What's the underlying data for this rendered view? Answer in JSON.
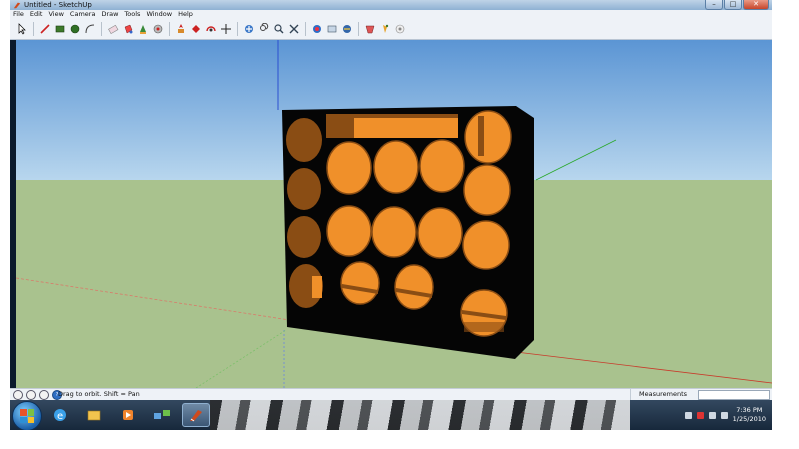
{
  "window": {
    "title": "Untitled - SketchUp",
    "buttons": [
      "–",
      "□",
      "✕"
    ]
  },
  "menu": [
    "File",
    "Edit",
    "View",
    "Camera",
    "Draw",
    "Tools",
    "Window",
    "Help"
  ],
  "toolbar": {
    "tools": [
      "select-icon",
      "line-icon",
      "rectangle-icon",
      "circle-icon",
      "arc-icon",
      "eraser-icon",
      "paint-bucket-icon",
      "push-pull-icon",
      "move-icon",
      "rotate-icon",
      "offset-icon",
      "orbit-icon",
      "pan-icon",
      "zoom-icon",
      "zoom-extents-icon",
      "tape-measure-icon",
      "dimension-icon",
      "text-icon",
      "axes-icon",
      "3d-text-icon",
      "section-plane-icon",
      "walk-icon",
      "look-around-icon"
    ]
  },
  "status": {
    "hint": "Drag to orbit. Shift = Pan",
    "measurements_label": "Measurements",
    "measurements_value": ""
  },
  "taskbar": {
    "apps": [
      "windows-explorer-icon",
      "internet-explorer-icon",
      "file-explorer-icon",
      "media-player-icon",
      "network-icon",
      "sketchup-icon"
    ],
    "clock_time": "7:36 PM",
    "clock_date": "1/25/2010"
  },
  "colors": {
    "sky": "#6fa6dc",
    "ground": "#a9c28e",
    "box": "#050505",
    "hole": "#f0902a",
    "hole_shadow": "#8a4d14"
  }
}
